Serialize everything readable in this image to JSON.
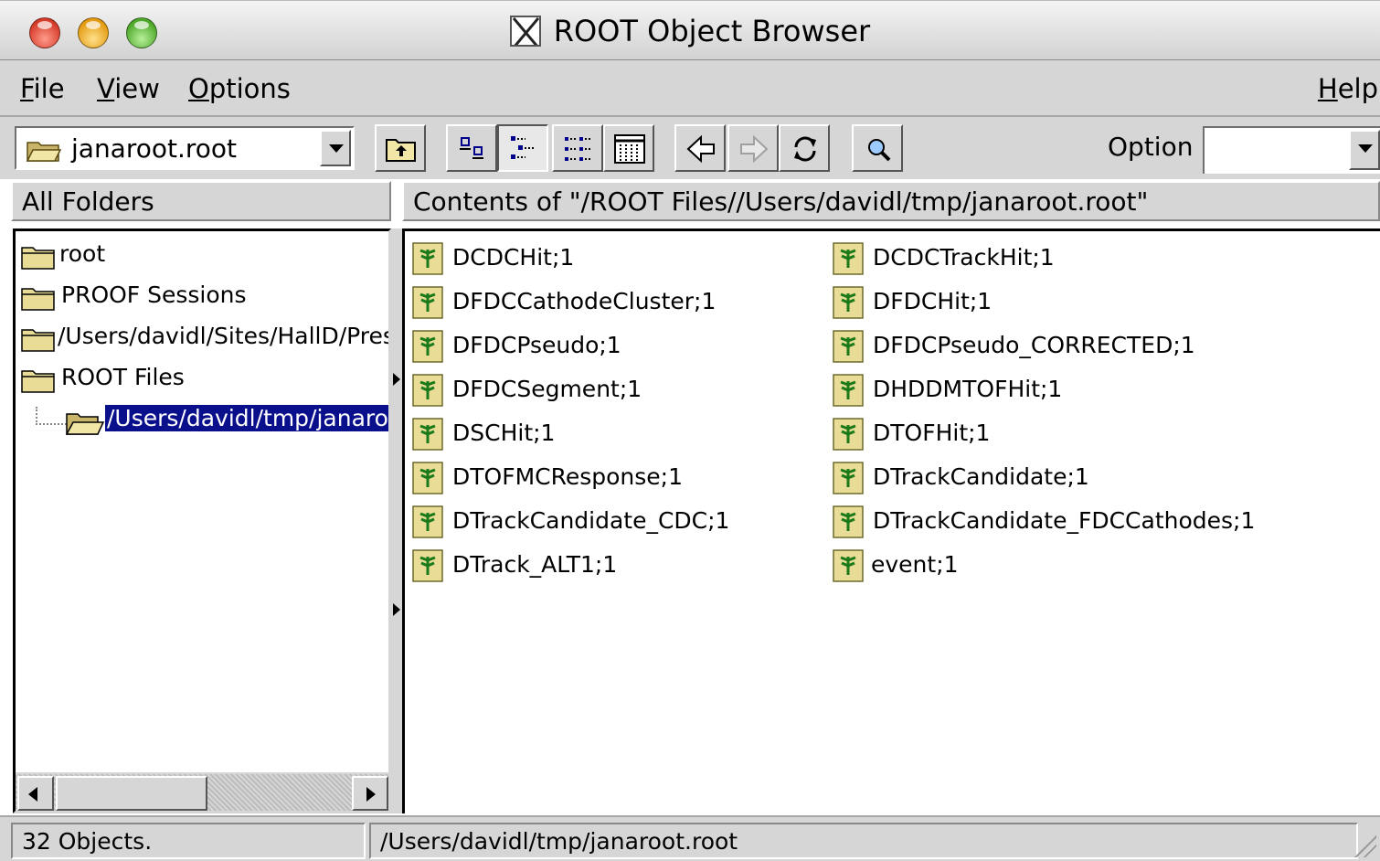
{
  "window": {
    "title": "ROOT Object Browser"
  },
  "menu": {
    "file": {
      "first": "F",
      "rest": "ile"
    },
    "view": {
      "first": "V",
      "rest": "iew"
    },
    "options": {
      "first": "O",
      "rest": "ptions"
    },
    "help": {
      "first": "H",
      "rest": "elp"
    }
  },
  "toolbar": {
    "path_combo_value": "janaroot.root",
    "option_label": "Option",
    "option_value": ""
  },
  "headers": {
    "left": "All Folders",
    "right": "Contents of \"/ROOT Files//Users/davidl/tmp/janaroot.root\""
  },
  "tree": [
    {
      "label": "root"
    },
    {
      "label": "PROOF Sessions"
    },
    {
      "label": "/Users/davidl/Sites/HallD/Prese"
    },
    {
      "label": "ROOT Files"
    },
    {
      "label": "/Users/davidl/tmp/janaroot.",
      "selected": true
    }
  ],
  "objects": {
    "col1": [
      "DCDCHit;1",
      "DFDCCathodeCluster;1",
      "DFDCPseudo;1",
      "DFDCSegment;1",
      "DSCHit;1",
      "DTOFMCResponse;1",
      "DTrackCandidate_CDC;1",
      "DTrack_ALT1;1"
    ],
    "col2": [
      "DCDCTrackHit;1",
      "DFDCHit;1",
      "DFDCPseudo_CORRECTED;1",
      "DHDDMTOFHit;1",
      "DTOFHit;1",
      "DTrackCandidate;1",
      "DTrackCandidate_FDCCathodes;1",
      "event;1"
    ]
  },
  "status": {
    "count": "32 Objects.",
    "path": "/Users/davidl/tmp/janaroot.root"
  },
  "colors": {
    "selection": "#0a0f8c",
    "chrome": "#d6d6d6"
  }
}
